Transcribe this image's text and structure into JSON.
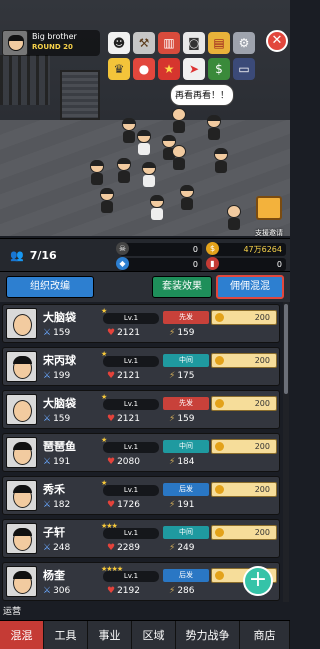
{
  "profile": {
    "name": "Big brother",
    "round": "ROUND 20"
  },
  "top_icons": [
    "wrestler-icon",
    "hammer-icon",
    "book-icon",
    "camera-icon",
    "cards-icon",
    "settings-icon",
    "close-icon",
    "rank-icon",
    "boxing-icon",
    "flag-icon",
    "paper-plane-icon",
    "money-icon",
    "tv-icon"
  ],
  "scene": {
    "speech": "再看再看！！",
    "support_label": "支援邀请"
  },
  "stats": {
    "members": "7/16",
    "skull_count": "0",
    "gem_count": "0",
    "gold": "47万6264",
    "ticket": "0"
  },
  "tabs": {
    "team": "组织改编",
    "outfit": "套装效果",
    "hire": "佣佣混混"
  },
  "members": [
    {
      "name": "大脑袋",
      "stars": "★",
      "level": "Lv.1",
      "atk": "159",
      "hp": "2121",
      "spd": "159",
      "position": "先发",
      "posColor": "red",
      "cost": "200",
      "bald": true
    },
    {
      "name": "宋丙球",
      "stars": "★",
      "level": "Lv.1",
      "atk": "199",
      "hp": "2121",
      "spd": "175",
      "position": "中间",
      "posColor": "teal",
      "cost": "200",
      "bald": false
    },
    {
      "name": "大脑袋",
      "stars": "★",
      "level": "Lv.1",
      "atk": "159",
      "hp": "2121",
      "spd": "159",
      "position": "先发",
      "posColor": "red",
      "cost": "200",
      "bald": true
    },
    {
      "name": "琶琶鱼",
      "stars": "★",
      "level": "Lv.1",
      "atk": "191",
      "hp": "2080",
      "spd": "184",
      "position": "中间",
      "posColor": "teal",
      "cost": "200",
      "bald": false
    },
    {
      "name": "秀禾",
      "stars": "★",
      "level": "Lv.1",
      "atk": "182",
      "hp": "1726",
      "spd": "191",
      "position": "后发",
      "posColor": "blue",
      "cost": "200",
      "bald": false
    },
    {
      "name": "子轩",
      "stars": "★★★",
      "level": "Lv.1",
      "atk": "248",
      "hp": "2289",
      "spd": "249",
      "position": "中间",
      "posColor": "teal",
      "cost": "200",
      "bald": false
    },
    {
      "name": "杨奎",
      "stars": "★★★★",
      "level": "Lv.1",
      "atk": "306",
      "hp": "2192",
      "spd": "286",
      "position": "后发",
      "posColor": "blue",
      "cost": "200",
      "bald": false
    }
  ],
  "ops_label": "运营",
  "nav": [
    "混混",
    "工具",
    "事业",
    "区域",
    "势力战争",
    "商店"
  ],
  "colors": {
    "accent": "#c53b35",
    "primary_blue": "#2d7fd0",
    "teal": "#1f9aa0",
    "gold": "#e3a21a"
  }
}
